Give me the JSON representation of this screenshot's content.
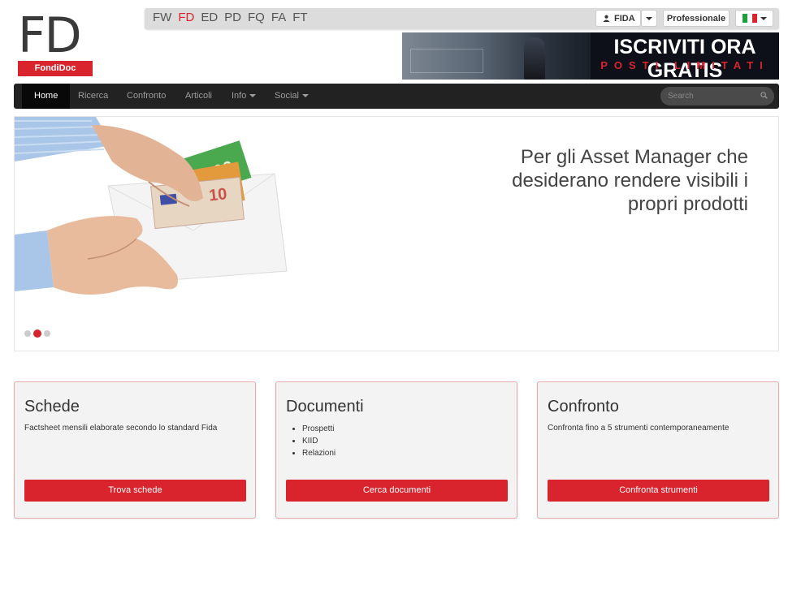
{
  "logo": {
    "letters": "FD",
    "subtitle": "FondiDoc"
  },
  "topbar": {
    "sites": [
      {
        "label": "FW",
        "active": false
      },
      {
        "label": "FD",
        "active": true
      },
      {
        "label": "ED",
        "active": false
      },
      {
        "label": "PD",
        "active": false
      },
      {
        "label": "FQ",
        "active": false
      },
      {
        "label": "FA",
        "active": false
      },
      {
        "label": "FT",
        "active": false
      }
    ],
    "user_label": "FIDA",
    "professional_label": "Professionale",
    "language_flag": "italy-flag"
  },
  "banner": {
    "line1": "ISCRIVITI ORA GRATIS",
    "line2": "POSTI LIMITATI"
  },
  "navbar": {
    "items": [
      {
        "label": "Home",
        "active": true,
        "dropdown": false
      },
      {
        "label": "Ricerca",
        "active": false,
        "dropdown": false
      },
      {
        "label": "Confronto",
        "active": false,
        "dropdown": false
      },
      {
        "label": "Articoli",
        "active": false,
        "dropdown": false
      },
      {
        "label": "Info",
        "active": false,
        "dropdown": true
      },
      {
        "label": "Social",
        "active": false,
        "dropdown": true
      }
    ],
    "search_placeholder": "Search"
  },
  "hero": {
    "text": "Per gli Asset Manager che desiderano rendere visibili i propri prodotti",
    "slides": 3,
    "active_slide": 2
  },
  "cards": [
    {
      "title": "Schede",
      "text": "Factsheet mensili elaborate secondo lo standard Fida",
      "items": [],
      "button": "Trova schede"
    },
    {
      "title": "Documenti",
      "text": "",
      "items": [
        "Prospetti",
        "KIID",
        "Relazioni"
      ],
      "button": "Cerca documenti"
    },
    {
      "title": "Confronto",
      "text": "Confronta fino a 5 strumenti contemporaneamente",
      "items": [],
      "button": "Confronta strumenti"
    }
  ],
  "colors": {
    "accent": "#d9232d",
    "navbar": "#222222",
    "card_bg": "#f3f3f3"
  }
}
